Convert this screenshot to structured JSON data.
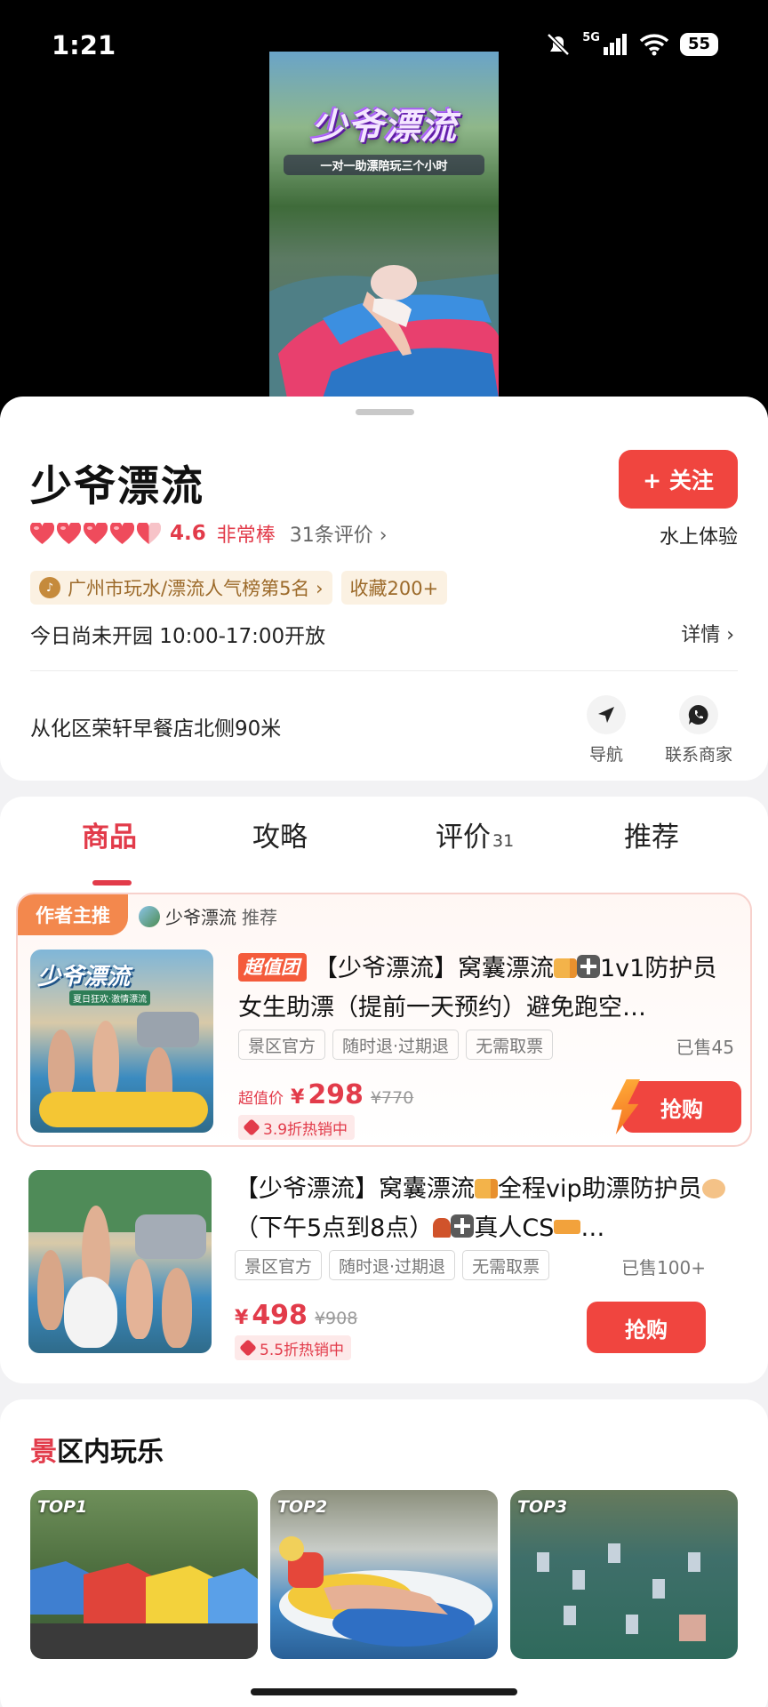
{
  "status_bar": {
    "time": "1:21",
    "network": "5G",
    "battery": "55"
  },
  "video": {
    "title": "少爷漂流",
    "subtitle": "一对一助漂陪玩三个小时"
  },
  "place": {
    "name": "少爷漂流",
    "follow_label": "+ 关注",
    "score": "4.6",
    "score_word": "非常棒",
    "review_count": "31条评价 ›",
    "category": "水上体验",
    "rank_tag": "广州市玩水/漂流人气榜第5名 ›",
    "collect_tag": "收藏200+",
    "hours": "今日尚未开园 10:00-17:00开放",
    "details": "详情 ›",
    "address": "从化区荣轩早餐店北侧90米",
    "nav_label": "导航",
    "contact_label": "联系商家"
  },
  "tabs": [
    {
      "label": "商品"
    },
    {
      "label": "攻略"
    },
    {
      "label": "评价",
      "count": "31"
    },
    {
      "label": "推荐"
    }
  ],
  "recommend": {
    "badge": "作者主推",
    "author": "少爷漂流",
    "suffix": "推荐"
  },
  "products": [
    {
      "badge": "超值团",
      "name_a": "【少爷漂流】窝囊漂流",
      "name_b": "1v1防护员女生助漂（提前一天预约）避免跑空…",
      "tags": [
        "景区官方",
        "随时退·过期退",
        "无需取票"
      ],
      "sold": "已售45",
      "price_label": "超值价",
      "price": "298",
      "orig_price": "¥770",
      "discount": "3.9折热销中",
      "buy": "抢购",
      "thumb_title": "少爷漂流",
      "thumb_sub": "夏日狂欢·激情漂流"
    },
    {
      "name_a": "【少爷漂流】窝囊漂流",
      "name_b": "全程vip助漂防护员",
      "name_c": "（下午5点到8点）",
      "name_d": "真人CS",
      "name_e": "…",
      "tags": [
        "景区官方",
        "随时退·过期退",
        "无需取票"
      ],
      "sold": "已售100+",
      "price": "498",
      "orig_price": "¥908",
      "discount": "5.5折热销中",
      "buy": "抢购"
    }
  ],
  "fun": {
    "title_first": "景",
    "title_rest": "区内玩乐",
    "items": [
      {
        "rank": "TOP1"
      },
      {
        "rank": "TOP2"
      },
      {
        "rank": "TOP3"
      }
    ]
  },
  "colors": {
    "accent": "#e23b4a",
    "button": "#f0453f",
    "badge_orange": "#f3884d"
  }
}
